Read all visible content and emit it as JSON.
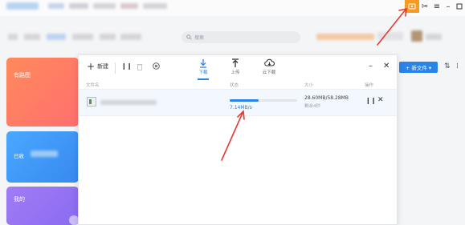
{
  "colors": {
    "accent": "#2a83e8",
    "orange": "#f59a23",
    "red_arrow": "#e53b32",
    "card1": "#ff7b63",
    "card2": "#3d9ef5",
    "card3": "#9a7bf2"
  },
  "topbar": {
    "search_placeholder": "搜索",
    "icons": [
      "coupon-icon",
      "scissors-icon",
      "menu-icon",
      "minimize-icon",
      "maximize-icon"
    ]
  },
  "left_cards": [
    {
      "label": "有路图"
    },
    {
      "label": "已收"
    },
    {
      "label": "我的"
    }
  ],
  "right_toolbar": {
    "new_button_label": "+ 新文件 ▾"
  },
  "panel": {
    "toolbar": {
      "new_label": "新建",
      "tabs": [
        {
          "label": "下载",
          "icon": "download-icon",
          "active": true
        },
        {
          "label": "上传",
          "icon": "upload-icon",
          "active": false
        },
        {
          "label": "云下载",
          "icon": "cloud-download-icon",
          "active": false
        }
      ]
    },
    "columns": {
      "name": "文件名",
      "status": "状态",
      "size": "大小",
      "action": "操作"
    },
    "task": {
      "progress_fraction": 0.43,
      "speed": "7.14MB/s",
      "size_text": "28.60MB/58.28MB",
      "time_text": "剩余4秒"
    }
  }
}
